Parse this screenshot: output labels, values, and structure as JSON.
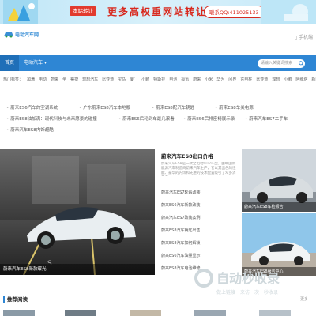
{
  "banner": {
    "tag_line1": "本站转让",
    "tag_line2": "出售",
    "slogan": "更多高权重网站转让",
    "contact": "联系QQ:411025133"
  },
  "header": {
    "logo_text": "电动汽车网",
    "mobile_label": "手机端"
  },
  "nav": {
    "home": "首页",
    "category": "电动汽车",
    "search_placeholder": "请输入关键词搜索"
  },
  "tags": [
    "热门标签：",
    "加满",
    "电动",
    "蔚来",
    "坐",
    "蒂捷",
    "理想汽车",
    "比亚迪",
    "宝马",
    "厦门",
    "小鹏",
    "特斯拉",
    "电池",
    "极氪",
    "蔚来",
    "小米",
    "华为",
    "问界",
    "充电桩",
    "比亚迪",
    "理想",
    "小鹏",
    "阿维塔",
    "新能源",
    "汽车",
    "宇通"
  ],
  "links": [
    "蔚来ES6汽车的空调系统",
    "广东蔚来ES8汽车本地版",
    "蔚来ES8配汽车钥匙",
    "蔚来ES8车关电源",
    "蔚来ES8油加满：现代科技与未来愿景的碰撞",
    "蔚来ES6后轮到车最几滚看",
    "蔚来ES6后排座椅展示录",
    "蔚来汽车ES7二手车",
    "蔚来汽车ES8内饰超酷"
  ],
  "hero": {
    "caption": "蔚来汽车ES8新款曝光"
  },
  "featured": {
    "title": "蔚来汽车ES8出口价格",
    "desc": "蔚来汽车ES8是一款全电动SUV车型，由中国新能源汽车制造商蔚来汽车生产，它以其出色的性能、豪华的内饰和先进的技术配置吸引了众多消费者",
    "items": [
      "蔚来汽车ES7轮毂改装",
      "蔚来ES6汽车新款改装",
      "蔚来汽车ES7改装案例",
      "蔚来ES8汽车钥匙出售",
      "蔚来ES8汽车如何解锁",
      "蔚来ES6汽车油量显示",
      "蔚来ES8汽车电池维修",
      "ES8蔚来汽车改装"
    ]
  },
  "thumbs": [
    {
      "caption": "蔚来汽车ES8车检报告"
    },
    {
      "caption": "蔚来汽车ES8服务中心"
    }
  ],
  "recommend": {
    "label": "推荐阅读",
    "more": "更多"
  },
  "watermark": {
    "brand": "自动秒收录",
    "sub": "做上链接一来访一次一秒收录"
  }
}
